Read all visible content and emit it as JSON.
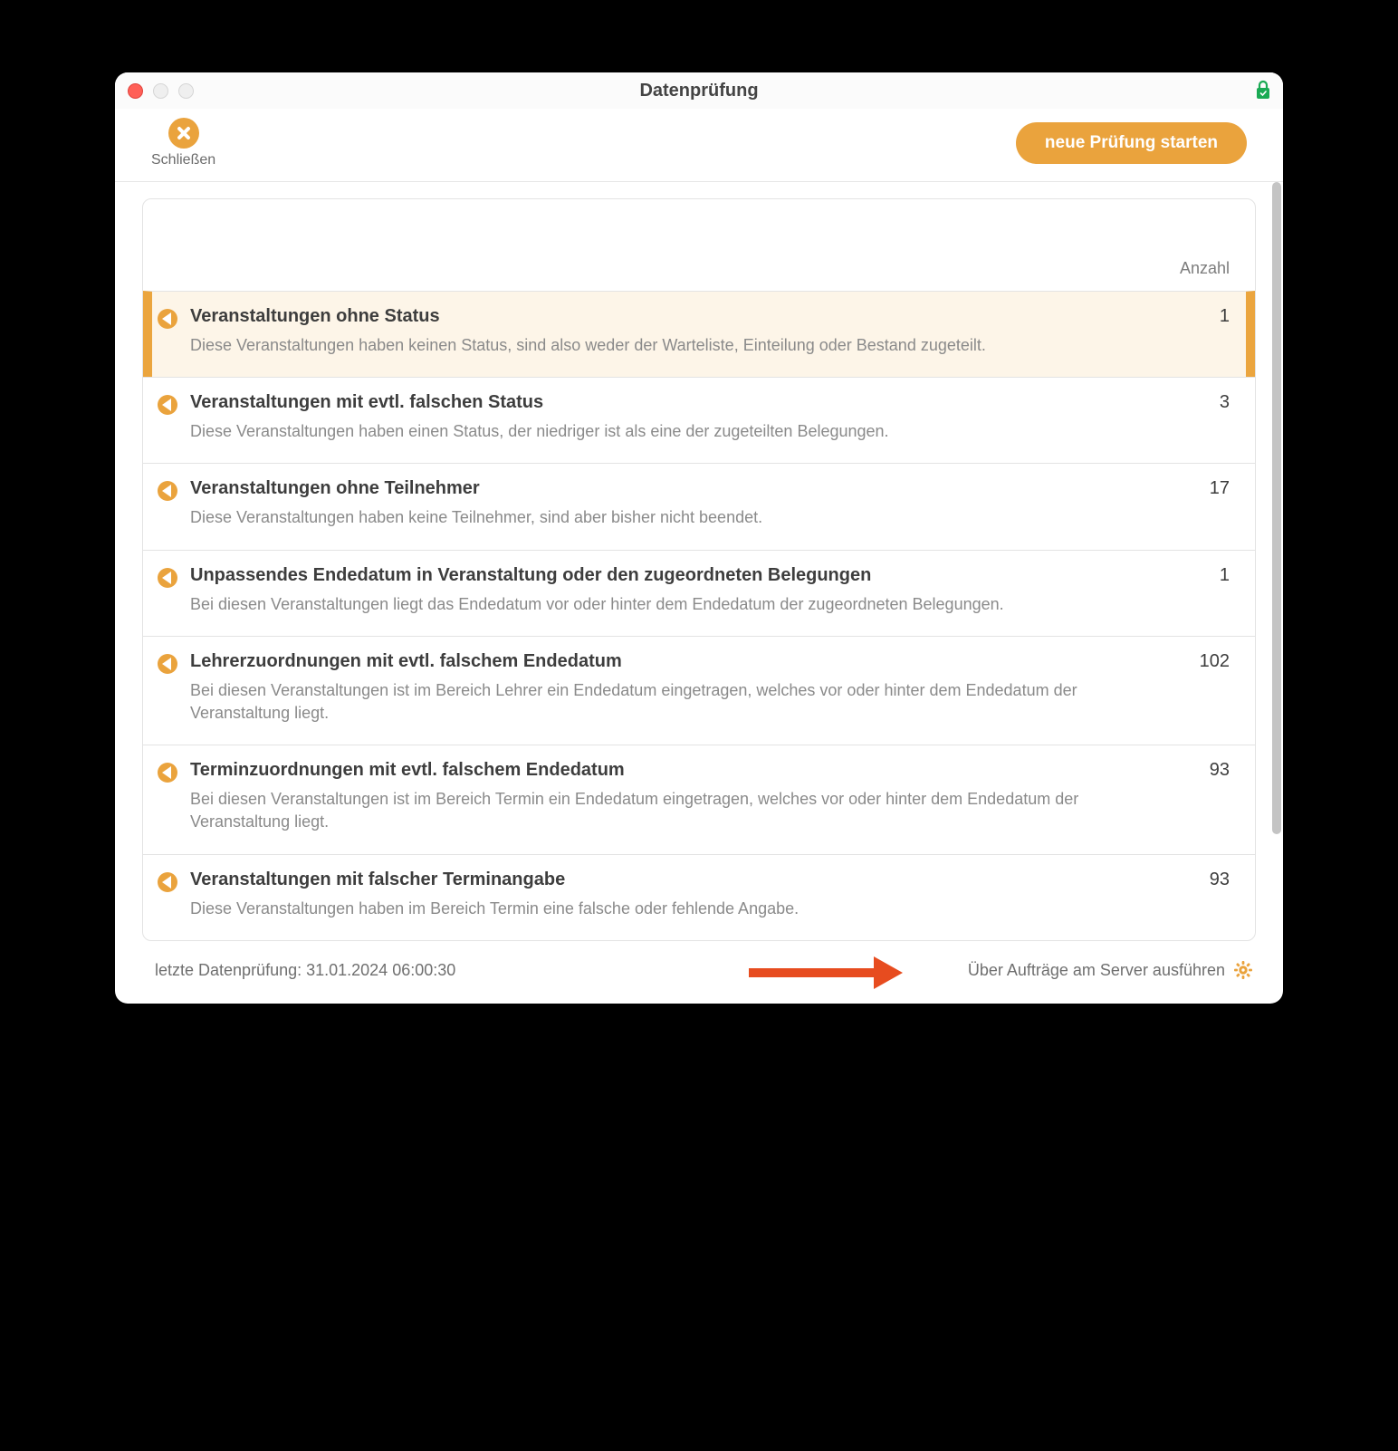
{
  "window": {
    "title": "Datenprüfung"
  },
  "toolbar": {
    "close_label": "Schließen",
    "start_button": "neue Prüfung starten"
  },
  "header": {
    "count_label": "Anzahl"
  },
  "rows": [
    {
      "title": "Veranstaltungen ohne Status",
      "desc": "Diese Veranstaltungen haben keinen Status, sind also weder der Warteliste, Einteilung oder Bestand zugeteilt.",
      "count": "1",
      "selected": true
    },
    {
      "title": "Veranstaltungen mit evtl. falschen Status",
      "desc": "Diese Veranstaltungen haben einen Status, der niedriger ist als eine der zugeteilten Belegungen.",
      "count": "3",
      "selected": false
    },
    {
      "title": "Veranstaltungen ohne Teilnehmer",
      "desc": "Diese Veranstaltungen haben keine Teilnehmer, sind aber bisher nicht beendet.",
      "count": "17",
      "selected": false
    },
    {
      "title": "Unpassendes Endedatum in Veranstaltung oder den zugeordneten Belegungen",
      "desc": "Bei diesen Veranstaltungen liegt das Endedatum vor oder hinter dem Endedatum der zugeordneten Belegungen.",
      "count": "1",
      "selected": false
    },
    {
      "title": "Lehrerzuordnungen mit evtl. falschem Endedatum",
      "desc": "Bei diesen Veranstaltungen ist im Bereich Lehrer ein Endedatum eingetragen, welches vor oder hinter dem Endedatum der Veranstaltung liegt.",
      "count": "102",
      "selected": false
    },
    {
      "title": "Terminzuordnungen mit evtl. falschem Endedatum",
      "desc": "Bei diesen Veranstaltungen ist im Bereich Termin ein Endedatum eingetragen, welches vor oder hinter dem Endedatum der Veranstaltung liegt.",
      "count": "93",
      "selected": false
    },
    {
      "title": "Veranstaltungen mit falscher Terminangabe",
      "desc": "Diese Veranstaltungen haben im Bereich Termin eine falsche oder fehlende Angabe.",
      "count": "93",
      "selected": false
    }
  ],
  "footer": {
    "last_check": "letzte Datenprüfung: 31.01.2024 06:00:30",
    "server_action": "Über Aufträge am Server ausführen"
  }
}
